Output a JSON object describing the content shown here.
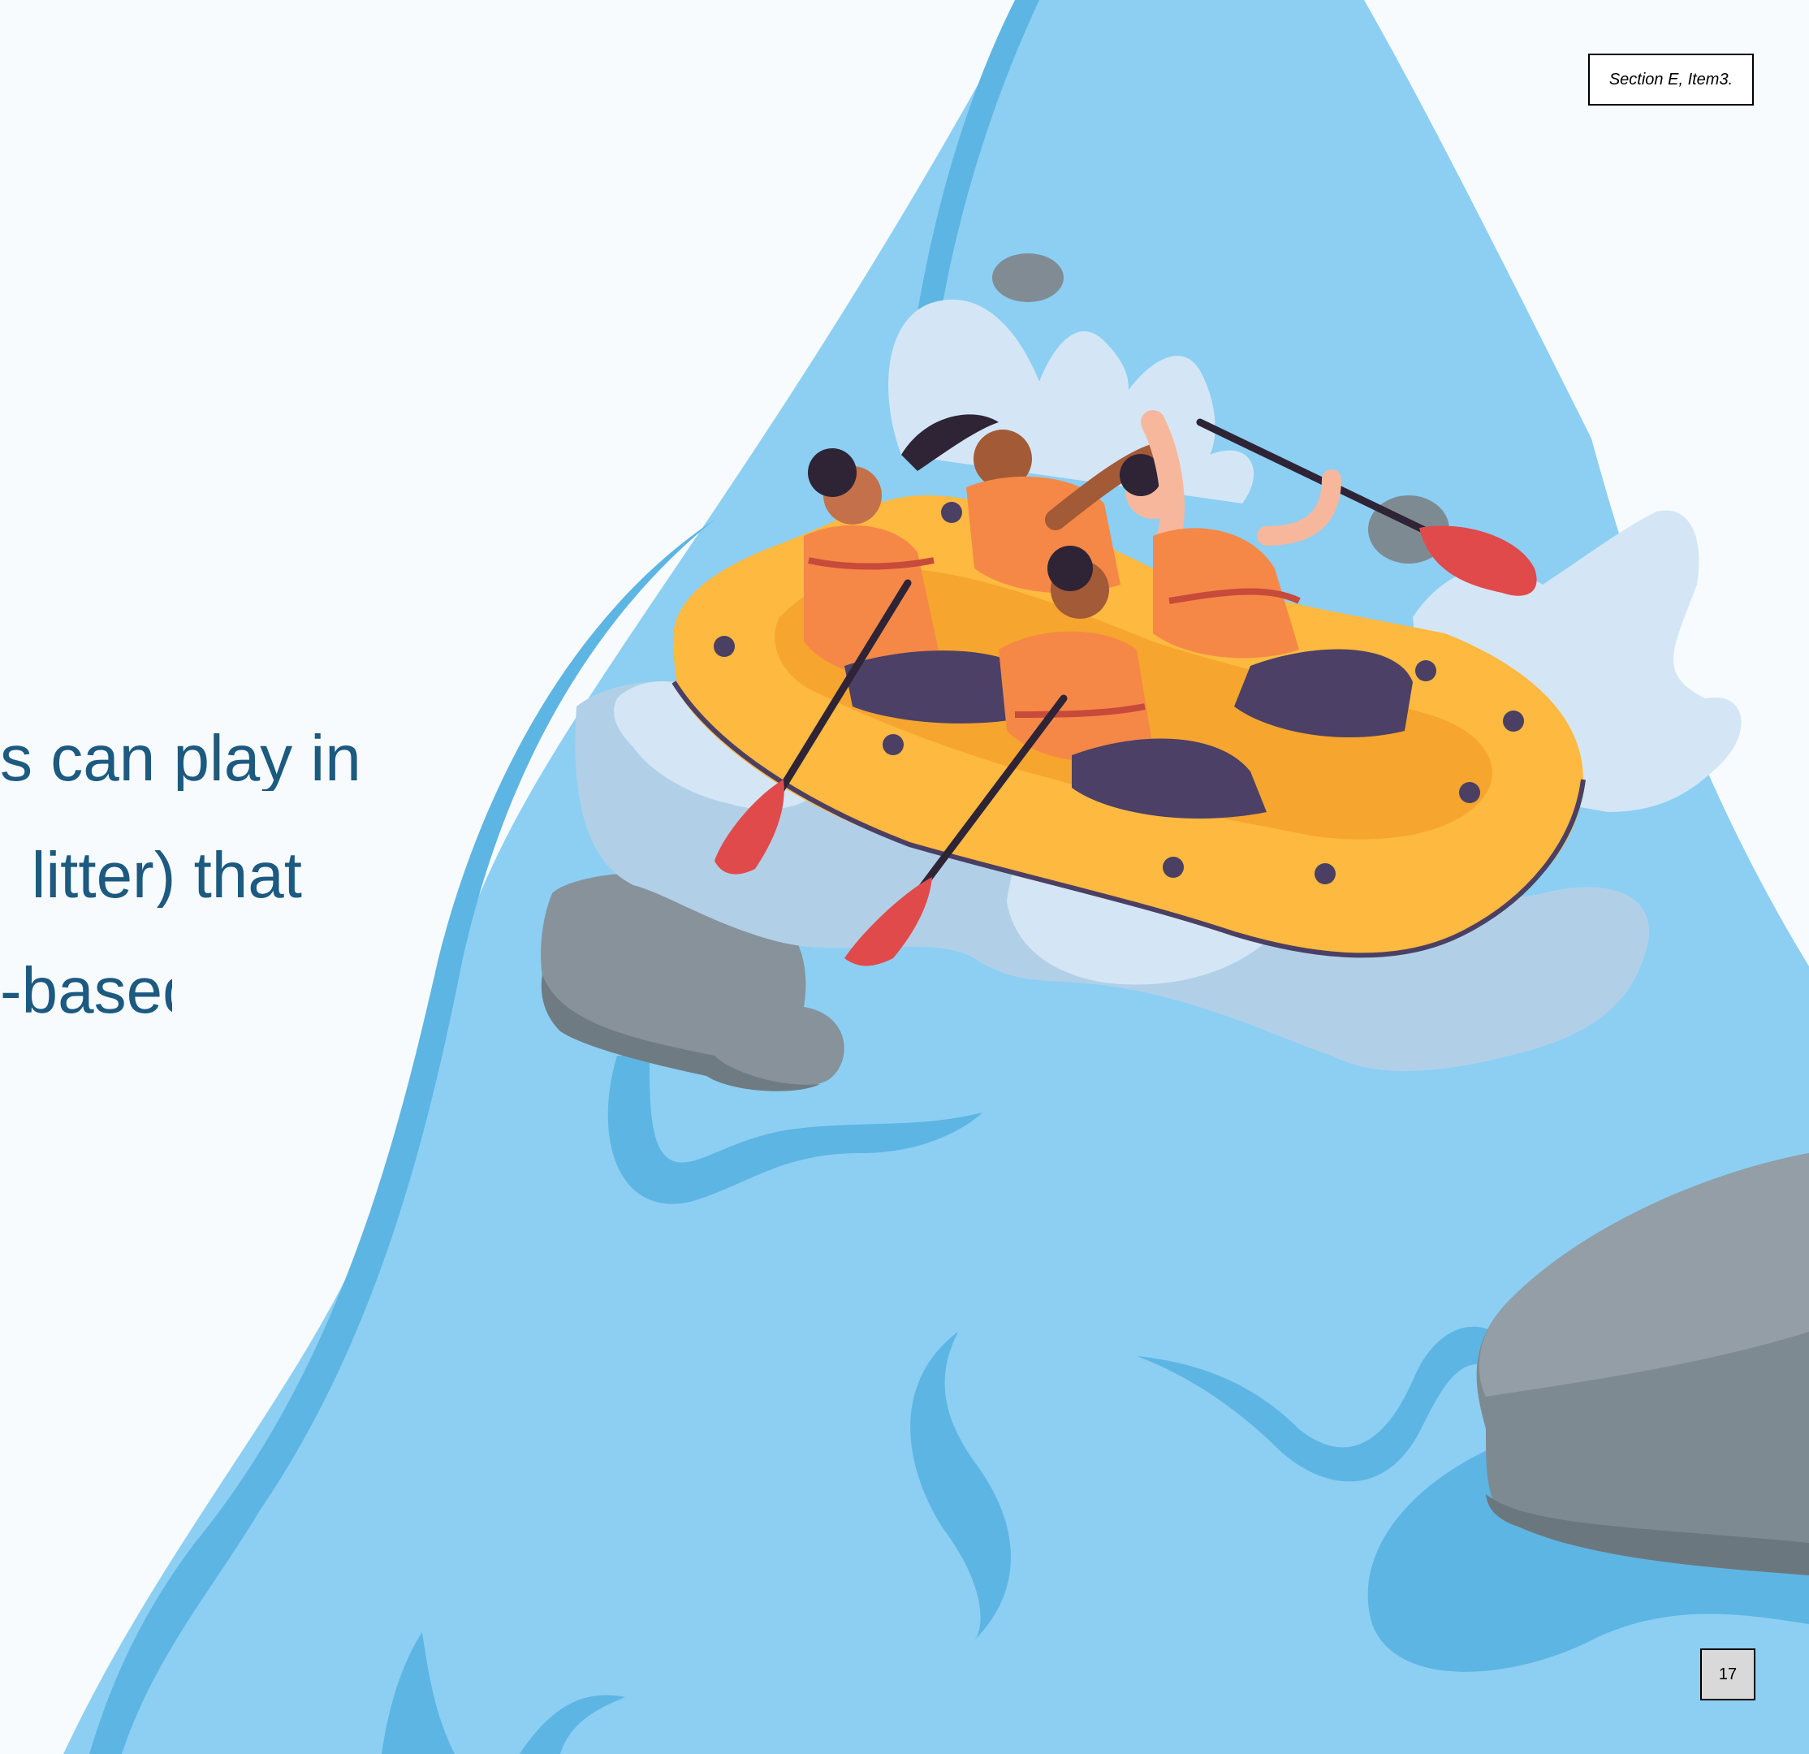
{
  "header": {
    "section_ref": "Section E, Item3."
  },
  "body": {
    "lines": [
      "s can play in a",
      "litter) that",
      "-based"
    ]
  },
  "footer": {
    "page_number": "17"
  },
  "illustration": {
    "subject": "whitewater-rafting-team",
    "colors": {
      "river": "#8ccff3",
      "river_shade": "#5db5e3",
      "foam": "#d4e6f5",
      "raft": "#fdb940",
      "vest": "#f58847",
      "paddle_blade": "#e04a4a",
      "rock": "#7e8a92"
    }
  }
}
